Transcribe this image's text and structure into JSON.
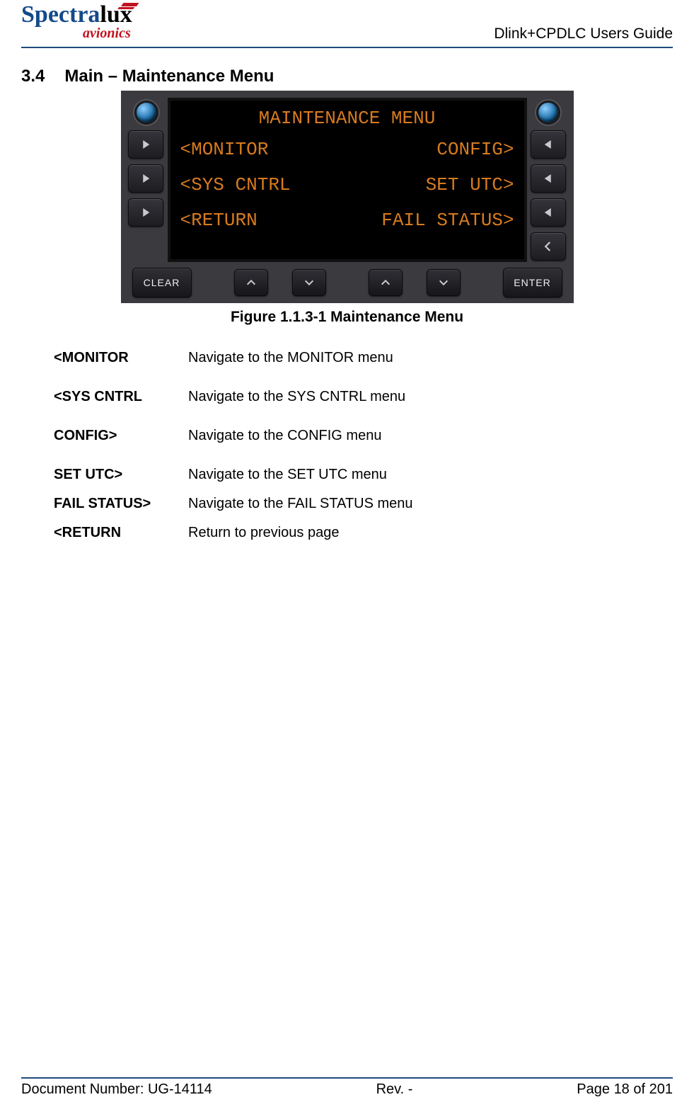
{
  "header": {
    "logo_part1": "Spectra",
    "logo_part2": "lux",
    "logo_sub": "avionics",
    "guide_title": "Dlink+CPDLC Users Guide"
  },
  "section": {
    "number": "3.4",
    "title": "Main – Maintenance Menu"
  },
  "screen": {
    "title": "MAINTENANCE MENU",
    "rows": [
      {
        "left": "<MONITOR",
        "right": "CONFIG>"
      },
      {
        "left": "<SYS CNTRL",
        "right": "SET UTC>"
      },
      {
        "left": "<RETURN",
        "right": "FAIL STATUS>"
      }
    ]
  },
  "buttons": {
    "clear": "CLEAR",
    "enter": "ENTER"
  },
  "caption": "Figure 1.1.3-1 Maintenance Menu",
  "desc": [
    {
      "term": "<MONITOR",
      "text": "Navigate to the MONITOR menu"
    },
    {
      "term": "<SYS CNTRL",
      "text": "Navigate to the SYS CNTRL menu"
    },
    {
      "term": "CONFIG>",
      "text": "Navigate to the CONFIG menu"
    },
    {
      "term": "SET UTC>",
      "text": "Navigate to the SET UTC menu"
    },
    {
      "term": "FAIL STATUS>",
      "text": "Navigate to the FAIL STATUS menu"
    },
    {
      "term": "<RETURN",
      "text": "Return to previous page"
    }
  ],
  "footer": {
    "doc": "Document Number:  UG-14114",
    "rev": "Rev. -",
    "page": "Page 18 of 201"
  }
}
